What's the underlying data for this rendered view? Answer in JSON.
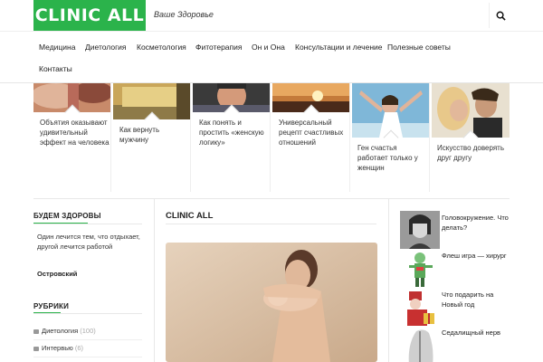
{
  "header": {
    "logo": "CLINIC ALL",
    "tagline": "Ваше Здоровье",
    "search_icon": "search-icon"
  },
  "nav": {
    "items": [
      "Медицина",
      "Диетология",
      "Косметология",
      "Фитотерапия",
      "Он и Она",
      "Консультации и лечение",
      "Полезные советы",
      "Контакты"
    ]
  },
  "featured": [
    {
      "title": "Объятия оказывают удивительный эффект на человека"
    },
    {
      "title": "Как вернуть мужчину"
    },
    {
      "title": "Как понять и простить «женскую логику»"
    },
    {
      "title": "Универсальный рецепт счастливых отношений"
    },
    {
      "title": "Ген счастья работает только у женщин"
    },
    {
      "title": "Искусство доверять друг другу"
    }
  ],
  "sidebar_left": {
    "quote_title": "БУДЕМ ЗДОРОВЫ",
    "quote_text": "Один лечится тем, что отдыхает, другой лечится работой",
    "quote_author": "Островский",
    "categories_title": "РУБРИКИ",
    "categories": [
      {
        "name": "Диетология",
        "count": "(100)"
      },
      {
        "name": "Интервью",
        "count": "(6)"
      }
    ]
  },
  "main": {
    "title": "CLINIC ALL"
  },
  "sidebar_right": {
    "items": [
      {
        "title": "Головокружение. Что делать?"
      },
      {
        "title": "Флеш игра — хирург"
      },
      {
        "title": "Что подарить на Новый год"
      },
      {
        "title": "Седалищный нерв"
      }
    ]
  },
  "colors": {
    "accent": "#2bb34b"
  }
}
